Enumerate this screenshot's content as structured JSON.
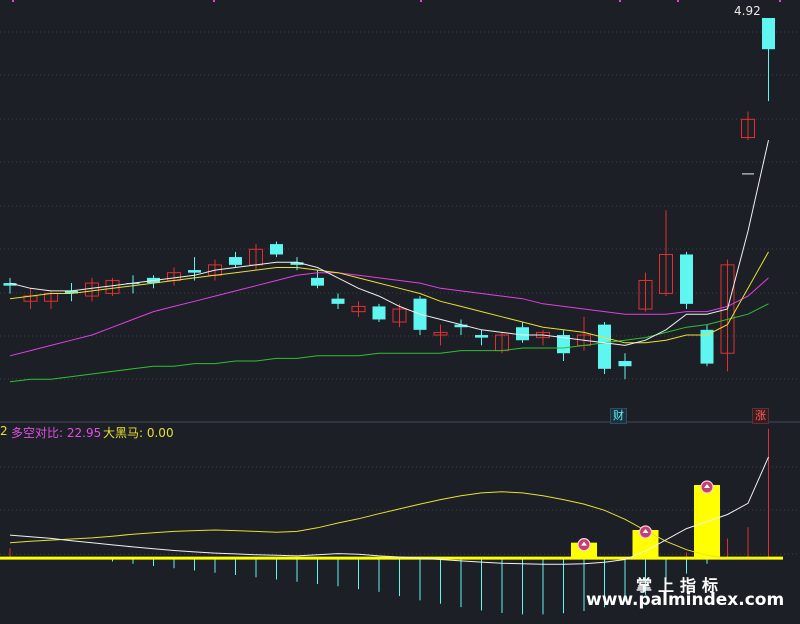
{
  "colors": {
    "background": "#1c1f26",
    "grid": "#3a3f4a",
    "candle_up": "#e03030",
    "candle_down": "#5ff5f0",
    "ma_white": "#f0f0f0",
    "ma_yellow": "#e8e030",
    "ma_magenta": "#e040e0",
    "ma_green": "#30c030",
    "bar_yellow": "#ffff00",
    "bar_cyan": "#5ff5f0",
    "bar_red": "#e03030",
    "text_magenta": "#e050e0",
    "text_yellow": "#e8e030"
  },
  "price_panel": {
    "last_price": "4.92",
    "badge_cai": "财",
    "badge_zhang": "涨"
  },
  "indicator_panel": {
    "prefix": "2",
    "label_duokong": "多空对比: 22.95",
    "label_daheima": "大黑马: 0.00",
    "marker_icon": "star-circle-icon"
  },
  "watermark": {
    "line1": "掌上指标",
    "line2": "www.palmindex.com"
  },
  "chart_data": [
    {
      "type": "candlestick",
      "title": "",
      "candles": [
        {
          "o": 3.9,
          "h": 3.92,
          "l": 3.86,
          "c": 3.89,
          "dir": "down"
        },
        {
          "o": 3.85,
          "h": 3.88,
          "l": 3.8,
          "c": 3.83,
          "dir": "up"
        },
        {
          "o": 3.83,
          "h": 3.87,
          "l": 3.8,
          "c": 3.86,
          "dir": "up"
        },
        {
          "o": 3.87,
          "h": 3.9,
          "l": 3.83,
          "c": 3.86,
          "dir": "down"
        },
        {
          "o": 3.85,
          "h": 3.92,
          "l": 3.83,
          "c": 3.9,
          "dir": "up"
        },
        {
          "o": 3.86,
          "h": 3.92,
          "l": 3.85,
          "c": 3.91,
          "dir": "up"
        },
        {
          "o": 3.9,
          "h": 3.93,
          "l": 3.86,
          "c": 3.9,
          "dir": "down"
        },
        {
          "o": 3.9,
          "h": 3.93,
          "l": 3.88,
          "c": 3.92,
          "dir": "down"
        },
        {
          "o": 3.91,
          "h": 3.96,
          "l": 3.89,
          "c": 3.94,
          "dir": "up"
        },
        {
          "o": 3.94,
          "h": 4.0,
          "l": 3.91,
          "c": 3.95,
          "dir": "down"
        },
        {
          "o": 3.93,
          "h": 3.99,
          "l": 3.91,
          "c": 3.97,
          "dir": "up"
        },
        {
          "o": 4.0,
          "h": 4.02,
          "l": 3.96,
          "c": 3.97,
          "dir": "down"
        },
        {
          "o": 3.97,
          "h": 4.05,
          "l": 3.95,
          "c": 4.03,
          "dir": "up"
        },
        {
          "o": 4.05,
          "h": 4.06,
          "l": 4.0,
          "c": 4.01,
          "dir": "down"
        },
        {
          "o": 3.98,
          "h": 4.0,
          "l": 3.95,
          "c": 3.97,
          "dir": "down"
        },
        {
          "o": 3.92,
          "h": 3.95,
          "l": 3.88,
          "c": 3.89,
          "dir": "down"
        },
        {
          "o": 3.84,
          "h": 3.86,
          "l": 3.8,
          "c": 3.82,
          "dir": "down"
        },
        {
          "o": 3.79,
          "h": 3.83,
          "l": 3.77,
          "c": 3.81,
          "dir": "up"
        },
        {
          "o": 3.81,
          "h": 3.82,
          "l": 3.75,
          "c": 3.76,
          "dir": "down"
        },
        {
          "o": 3.75,
          "h": 3.82,
          "l": 3.73,
          "c": 3.8,
          "dir": "up"
        },
        {
          "o": 3.84,
          "h": 3.85,
          "l": 3.7,
          "c": 3.72,
          "dir": "down"
        },
        {
          "o": 3.7,
          "h": 3.74,
          "l": 3.66,
          "c": 3.71,
          "dir": "up"
        },
        {
          "o": 3.74,
          "h": 3.76,
          "l": 3.7,
          "c": 3.73,
          "dir": "down"
        },
        {
          "o": 3.7,
          "h": 3.72,
          "l": 3.66,
          "c": 3.69,
          "dir": "down"
        },
        {
          "o": 3.64,
          "h": 3.71,
          "l": 3.63,
          "c": 3.7,
          "dir": "up"
        },
        {
          "o": 3.73,
          "h": 3.75,
          "l": 3.67,
          "c": 3.68,
          "dir": "down"
        },
        {
          "o": 3.69,
          "h": 3.72,
          "l": 3.66,
          "c": 3.71,
          "dir": "up"
        },
        {
          "o": 3.7,
          "h": 3.72,
          "l": 3.6,
          "c": 3.63,
          "dir": "down"
        },
        {
          "o": 3.66,
          "h": 3.77,
          "l": 3.64,
          "c": 3.7,
          "dir": "up"
        },
        {
          "o": 3.74,
          "h": 3.75,
          "l": 3.55,
          "c": 3.57,
          "dir": "down"
        },
        {
          "o": 3.6,
          "h": 3.63,
          "l": 3.53,
          "c": 3.58,
          "dir": "down"
        },
        {
          "o": 3.8,
          "h": 3.94,
          "l": 3.79,
          "c": 3.91,
          "dir": "up"
        },
        {
          "o": 3.86,
          "h": 4.18,
          "l": 3.85,
          "c": 4.01,
          "dir": "up"
        },
        {
          "o": 4.01,
          "h": 4.02,
          "l": 3.8,
          "c": 3.82,
          "dir": "down"
        },
        {
          "o": 3.72,
          "h": 3.74,
          "l": 3.58,
          "c": 3.59,
          "dir": "down"
        },
        {
          "o": 3.63,
          "h": 3.99,
          "l": 3.56,
          "c": 3.97,
          "dir": "up"
        },
        {
          "o": 4.46,
          "h": 4.56,
          "l": 4.45,
          "c": 4.53,
          "dir": "up"
        },
        {
          "o": 4.92,
          "h": 4.92,
          "l": 4.6,
          "c": 4.8,
          "dir": "down"
        }
      ],
      "ma_white": [
        3.9,
        3.88,
        3.87,
        3.87,
        3.88,
        3.89,
        3.9,
        3.91,
        3.92,
        3.93,
        3.95,
        3.96,
        3.97,
        3.98,
        3.98,
        3.96,
        3.92,
        3.88,
        3.85,
        3.81,
        3.78,
        3.76,
        3.74,
        3.72,
        3.71,
        3.7,
        3.7,
        3.69,
        3.68,
        3.67,
        3.66,
        3.68,
        3.72,
        3.78,
        3.78,
        3.8,
        4.1,
        4.45
      ],
      "ma_yellow": [
        3.84,
        3.85,
        3.86,
        3.86,
        3.87,
        3.88,
        3.89,
        3.9,
        3.91,
        3.92,
        3.93,
        3.94,
        3.95,
        3.96,
        3.96,
        3.95,
        3.94,
        3.92,
        3.9,
        3.88,
        3.86,
        3.83,
        3.81,
        3.79,
        3.77,
        3.75,
        3.73,
        3.72,
        3.71,
        3.69,
        3.67,
        3.67,
        3.68,
        3.7,
        3.7,
        3.74,
        3.88,
        4.02
      ],
      "ma_magenta": [
        3.62,
        3.64,
        3.66,
        3.68,
        3.7,
        3.73,
        3.76,
        3.79,
        3.81,
        3.83,
        3.85,
        3.87,
        3.89,
        3.91,
        3.93,
        3.94,
        3.94,
        3.93,
        3.92,
        3.91,
        3.9,
        3.88,
        3.87,
        3.86,
        3.85,
        3.84,
        3.82,
        3.81,
        3.8,
        3.79,
        3.78,
        3.78,
        3.78,
        3.79,
        3.79,
        3.81,
        3.85,
        3.92
      ],
      "ma_green": [
        3.52,
        3.53,
        3.53,
        3.54,
        3.55,
        3.56,
        3.57,
        3.58,
        3.58,
        3.59,
        3.59,
        3.6,
        3.6,
        3.61,
        3.61,
        3.62,
        3.62,
        3.62,
        3.63,
        3.63,
        3.63,
        3.63,
        3.64,
        3.64,
        3.64,
        3.65,
        3.65,
        3.65,
        3.66,
        3.67,
        3.68,
        3.69,
        3.71,
        3.73,
        3.74,
        3.76,
        3.78,
        3.82
      ],
      "extra_tick": 4.32,
      "ylim": [
        3.45,
        4.97
      ]
    },
    {
      "type": "bar",
      "title": "",
      "white_line": [
        0.82,
        0.76,
        0.7,
        0.62,
        0.55,
        0.47,
        0.4,
        0.33,
        0.27,
        0.22,
        0.18,
        0.15,
        0.12,
        0.1,
        0.08,
        0.12,
        0.16,
        0.14,
        0.08,
        0.04,
        0.0,
        -0.05,
        -0.1,
        -0.14,
        -0.18,
        -0.2,
        -0.22,
        -0.22,
        -0.2,
        -0.15,
        -0.05,
        0.25,
        0.65,
        1.05,
        1.3,
        1.55,
        1.95,
        3.6
      ],
      "yellow_line": [
        0.55,
        0.6,
        0.64,
        0.68,
        0.72,
        0.78,
        0.85,
        0.9,
        0.95,
        0.98,
        1.0,
        0.98,
        0.95,
        0.92,
        0.95,
        1.08,
        1.25,
        1.4,
        1.58,
        1.75,
        1.92,
        2.08,
        2.22,
        2.32,
        2.36,
        2.32,
        2.22,
        2.08,
        1.92,
        1.7,
        1.38,
        0.98,
        0.6,
        0.3,
        0.1,
        0.0,
        0.0,
        0.0
      ],
      "yellow_bars": [
        0,
        0,
        0,
        0,
        0,
        0,
        0,
        0,
        0,
        0,
        0,
        0,
        0,
        0,
        0,
        0,
        0,
        0,
        0,
        0,
        0,
        0,
        0,
        0,
        0,
        0,
        0,
        0,
        0.55,
        0,
        0,
        1.0,
        0,
        0,
        2.6,
        0,
        0,
        0
      ],
      "cyan_bars": [
        0,
        0,
        0,
        0,
        -0.05,
        -0.12,
        -0.2,
        -0.28,
        -0.36,
        -0.44,
        -0.52,
        -0.6,
        -0.68,
        -0.76,
        -0.84,
        -0.92,
        -1.0,
        -1.1,
        -1.2,
        -1.35,
        -1.5,
        -1.62,
        -1.74,
        -1.86,
        -1.95,
        -2.0,
        -2.0,
        -1.96,
        -1.88,
        -1.75,
        -1.55,
        -1.3,
        -0.95,
        -0.55,
        -0.2,
        0,
        0,
        0
      ],
      "red_bars": [
        0.35,
        0,
        0,
        0,
        0,
        0,
        0,
        0,
        0,
        0,
        0,
        0,
        0,
        0,
        0,
        0,
        0,
        0,
        0,
        0,
        0,
        0,
        0,
        0,
        0,
        0,
        0,
        0,
        0,
        0,
        0,
        0,
        0,
        0.2,
        0.45,
        0.7,
        1.1,
        4.6
      ],
      "markers": [
        28,
        31,
        34
      ],
      "ylim": [
        -2.2,
        4.2
      ]
    }
  ]
}
